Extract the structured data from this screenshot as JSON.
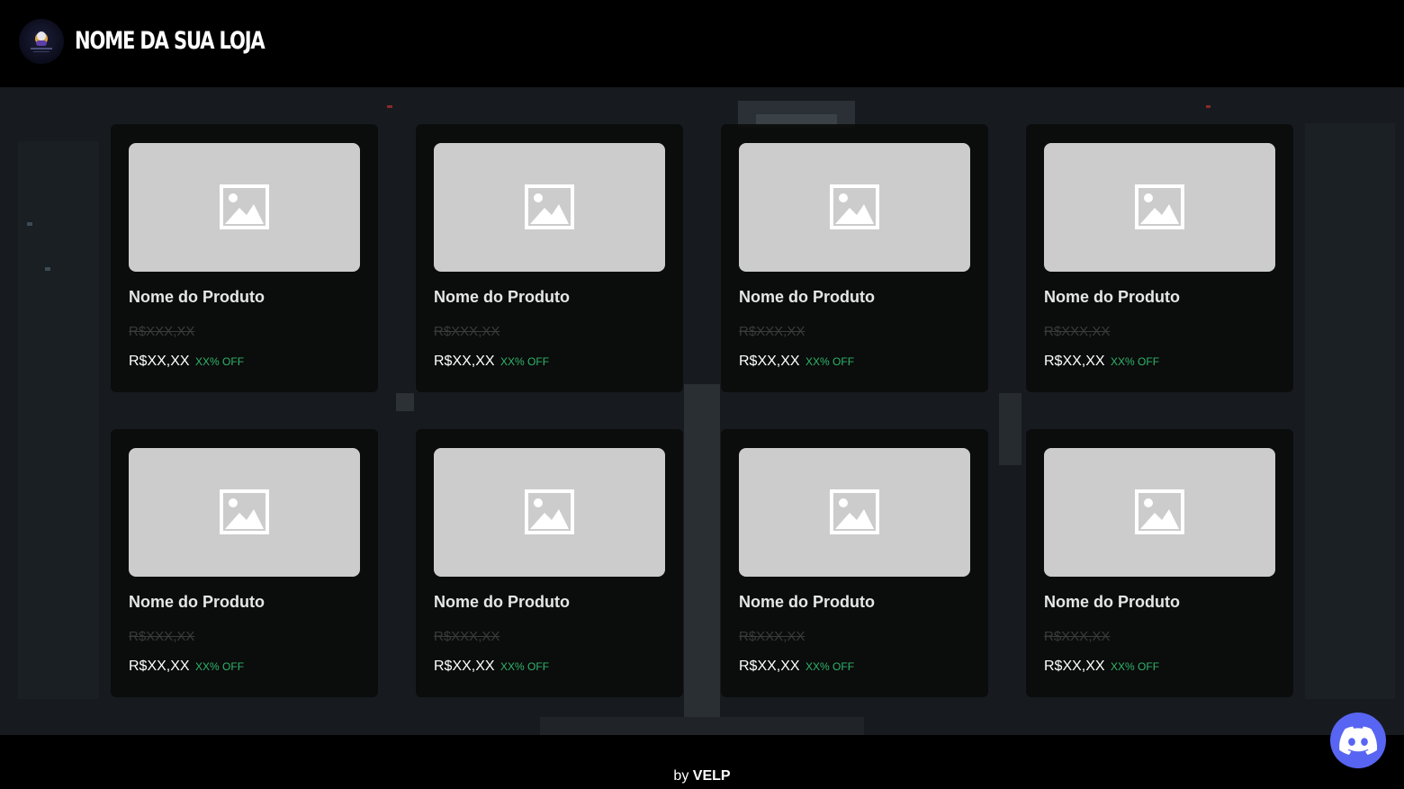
{
  "header": {
    "store_name": "NOME DA SUA LOJA",
    "logo_icon": "store-logo-icon"
  },
  "products": [
    {
      "name": "Nome do Produto",
      "old_price": "R$XXX,XX",
      "price": "R$XX,XX",
      "discount": "XX% OFF"
    },
    {
      "name": "Nome do Produto",
      "old_price": "R$XXX,XX",
      "price": "R$XX,XX",
      "discount": "XX% OFF"
    },
    {
      "name": "Nome do Produto",
      "old_price": "R$XXX,XX",
      "price": "R$XX,XX",
      "discount": "XX% OFF"
    },
    {
      "name": "Nome do Produto",
      "old_price": "R$XXX,XX",
      "price": "R$XX,XX",
      "discount": "XX% OFF"
    },
    {
      "name": "Nome do Produto",
      "old_price": "R$XXX,XX",
      "price": "R$XX,XX",
      "discount": "XX% OFF"
    },
    {
      "name": "Nome do Produto",
      "old_price": "R$XXX,XX",
      "price": "R$XX,XX",
      "discount": "XX% OFF"
    },
    {
      "name": "Nome do Produto",
      "old_price": "R$XXX,XX",
      "price": "R$XX,XX",
      "discount": "XX% OFF"
    },
    {
      "name": "Nome do Produto",
      "old_price": "R$XXX,XX",
      "price": "R$XX,XX",
      "discount": "XX% OFF"
    }
  ],
  "footer": {
    "prefix": "by",
    "brand": "VELP"
  },
  "discord": {
    "icon": "discord-icon"
  },
  "colors": {
    "discount_green": "#2fb56b",
    "discord_blue": "#5865f2",
    "placeholder_gray": "#cccccc"
  }
}
